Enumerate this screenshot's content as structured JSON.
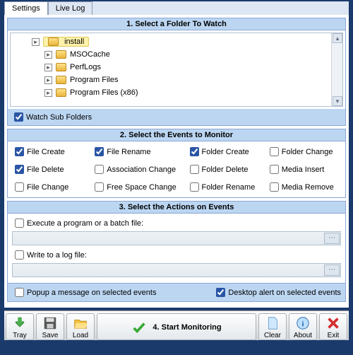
{
  "tabs": {
    "settings": "Settings",
    "livelog": "Live Log"
  },
  "section1": {
    "title": "1. Select a Folder To Watch",
    "items": [
      "install",
      "MSOCache",
      "PerfLogs",
      "Program Files",
      "Program Files (x86)"
    ],
    "watch_sub": "Watch Sub Folders"
  },
  "section2": {
    "title": "2. Select the Events to Monitor",
    "file_create": "File Create",
    "file_rename": "File Rename",
    "folder_create": "Folder Create",
    "folder_change": "Folder Change",
    "file_delete": "File Delete",
    "association_change": "Association Change",
    "folder_delete": "Folder Delete",
    "media_insert": "Media Insert",
    "file_change": "File Change",
    "free_space_change": "Free Space Change",
    "folder_rename": "Folder Rename",
    "media_remove": "Media Remove"
  },
  "section3": {
    "title": "3. Select the Actions on Events",
    "execute": "Execute a program or a batch file:",
    "writelog": "Write to a log file:",
    "popup": "Popup a message on selected events",
    "desktop_alert": "Desktop alert on selected events"
  },
  "toolbar": {
    "tray": "Tray",
    "save": "Save",
    "load": "Load",
    "start": "4. Start Monitoring",
    "clear": "Clear",
    "about": "About",
    "exit": "Exit"
  }
}
